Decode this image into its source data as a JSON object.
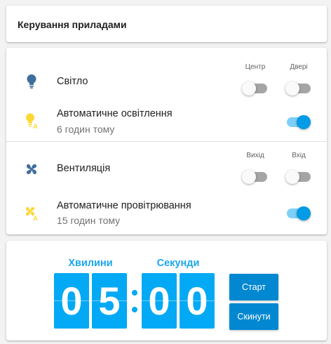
{
  "header": {
    "title": "Керування приладами"
  },
  "colors": {
    "icon_blue": "#3d6e9e",
    "icon_yellow": "#fdd835",
    "toggle_on": "#039be5",
    "toggle_off": "#a5a5a5",
    "timer_blue": "#03a9f4",
    "button_blue": "#0288d1"
  },
  "devices": {
    "light": {
      "icon": "lightbulb-icon",
      "label": "Світло",
      "toggle_headers": [
        "Центр",
        "Двері"
      ],
      "toggles": [
        false,
        false
      ]
    },
    "auto_light": {
      "icon": "lightbulb-auto-icon",
      "label": "Автоматичне освітлення",
      "sublabel": "6 годин тому",
      "toggle": true
    },
    "ventilation": {
      "icon": "fan-icon",
      "label": "Вентиляція",
      "toggle_headers": [
        "Вихід",
        "Вхід"
      ],
      "toggles": [
        false,
        false
      ]
    },
    "auto_ventilation": {
      "icon": "fan-auto-icon",
      "label": "Автоматичне провітрювання",
      "sublabel": "15 годин тому",
      "toggle": true
    }
  },
  "timer": {
    "minutes_label": "Хвилини",
    "seconds_label": "Секунди",
    "digits": [
      "0",
      "5",
      "0",
      "0"
    ],
    "start_label": "Старт",
    "reset_label": "Скинути"
  }
}
